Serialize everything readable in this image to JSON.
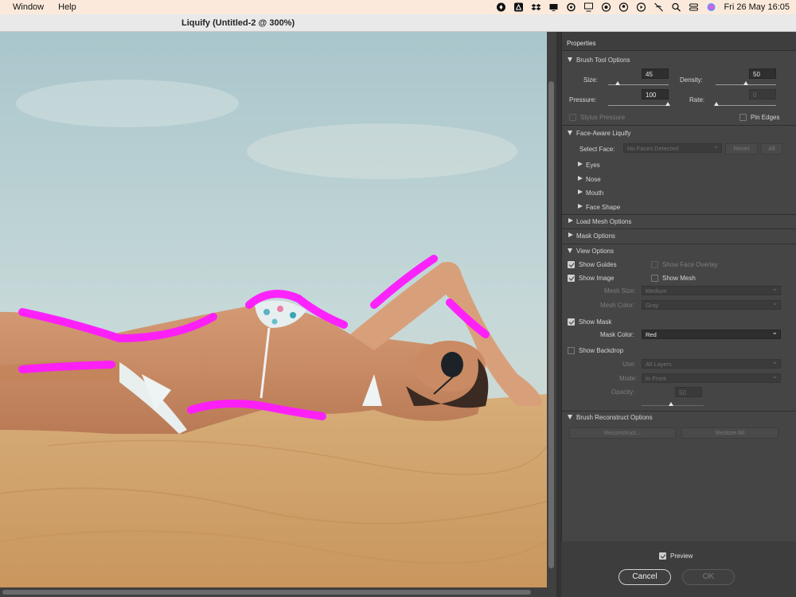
{
  "menubar": {
    "items": [
      "Window",
      "Help"
    ],
    "clock": "Fri 26 May  16:05"
  },
  "window": {
    "title": "Liquify (Untitled-2 @ 300%)"
  },
  "panel": {
    "title": "Properties",
    "brush_tool": {
      "header": "Brush Tool Options",
      "size_label": "Size:",
      "size_value": "45",
      "density_label": "Density:",
      "density_value": "50",
      "pressure_label": "Pressure:",
      "pressure_value": "100",
      "rate_label": "Rate:",
      "rate_value": "0",
      "stylus_label": "Stylus Pressure",
      "pin_edges_label": "Pin Edges"
    },
    "face_aware": {
      "header": "Face-Aware Liquify",
      "select_face_label": "Select Face:",
      "select_face_value": "No Faces Detected",
      "reset_label": "Reset",
      "all_label": "All",
      "items": [
        "Eyes",
        "Nose",
        "Mouth",
        "Face Shape"
      ]
    },
    "load_mesh": {
      "header": "Load Mesh Options"
    },
    "mask_options": {
      "header": "Mask Options"
    },
    "view_options": {
      "header": "View Options",
      "show_guides": "Show Guides",
      "show_face_overlay": "Show Face Overlay",
      "show_image": "Show Image",
      "show_mesh": "Show Mesh",
      "mesh_size_label": "Mesh Size:",
      "mesh_size_value": "Medium",
      "mesh_color_label": "Mesh Color:",
      "mesh_color_value": "Gray",
      "show_mask": "Show Mask",
      "mask_color_label": "Mask Color:",
      "mask_color_value": "Red",
      "show_backdrop": "Show Backdrop",
      "use_label": "Use:",
      "use_value": "All Layers",
      "mode_label": "Mode:",
      "mode_value": "In Front",
      "opacity_label": "Opacity:",
      "opacity_value": "50"
    },
    "brush_reconstruct": {
      "header": "Brush Reconstruct Options",
      "reconstruct_label": "Reconstruct...",
      "restore_all_label": "Restore All"
    }
  },
  "footer": {
    "preview_label": "Preview",
    "cancel_label": "Cancel",
    "ok_label": "OK"
  },
  "colors": {
    "mask_stroke": "#ff1aff",
    "panel_bg": "#454545",
    "sky": "#bcd3d6",
    "sand": "#d4a46c"
  }
}
